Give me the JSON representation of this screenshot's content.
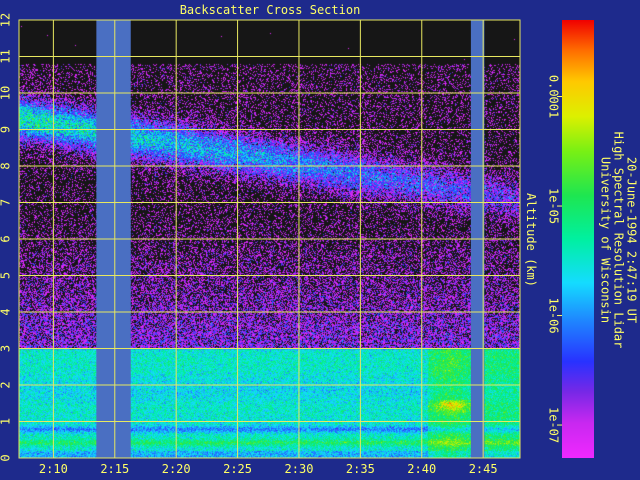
{
  "colors": {
    "background": "#1e2a8c",
    "text": "#ffff66",
    "grid": "#e8e860",
    "gap": "#4a6fc2"
  },
  "chart_data": {
    "type": "heatmap",
    "title": "Backscatter Cross Section",
    "ylabel": "Altitude (km)",
    "xlabel": "",
    "x_ticks": [
      "2:10",
      "2:15",
      "2:20",
      "2:25",
      "2:30",
      "2:35",
      "2:40",
      "2:45"
    ],
    "x_tick_minutes": [
      10,
      15,
      20,
      25,
      30,
      35,
      40,
      45
    ],
    "xlim_minutes": [
      7.2,
      48.0
    ],
    "y_ticks": [
      "0",
      "1",
      "2",
      "3",
      "4",
      "5",
      "6",
      "7",
      "8",
      "9",
      "10",
      "11",
      "12"
    ],
    "ylim": [
      0,
      12
    ],
    "grid": true,
    "data_gaps_minutes": [
      [
        13.5,
        16.3
      ],
      [
        44.0,
        45.1
      ]
    ],
    "colorbar": {
      "scale": "log",
      "range": [
        5e-08,
        0.0005
      ],
      "tick_labels": [
        "1e-07",
        "1e-06",
        "1e-05",
        "0.0001"
      ],
      "tick_values": [
        1e-07,
        1e-06,
        1e-05,
        0.0001
      ]
    },
    "credit_lines": [
      "University of Wisconsin",
      "High Spectral Resolution Lidar",
      "20-June-1994  2:47:19 UT"
    ]
  }
}
